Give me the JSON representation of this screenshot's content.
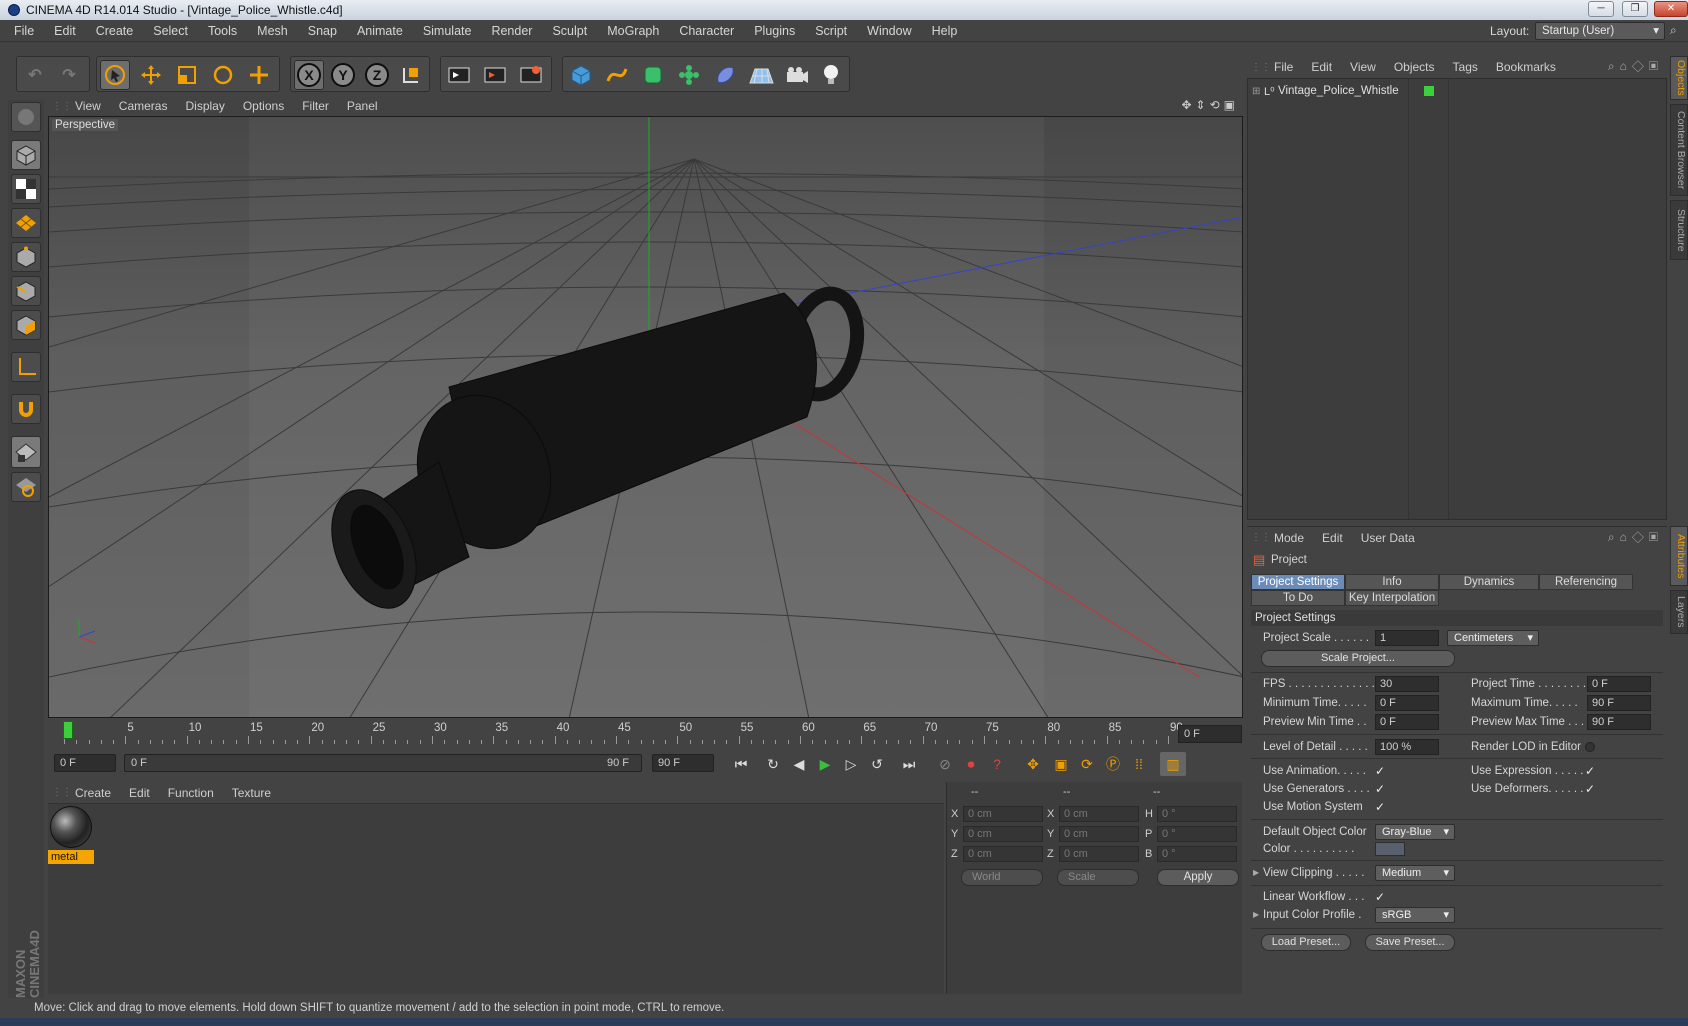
{
  "title": "CINEMA 4D R14.014 Studio - [Vintage_Police_Whistle.c4d]",
  "window": {
    "min": "─",
    "max": "❐",
    "close": "✕"
  },
  "menubar": [
    "File",
    "Edit",
    "Create",
    "Select",
    "Tools",
    "Mesh",
    "Snap",
    "Animate",
    "Simulate",
    "Render",
    "Sculpt",
    "MoGraph",
    "Character",
    "Plugins",
    "Script",
    "Window",
    "Help"
  ],
  "layout": {
    "label": "Layout:",
    "value": "Startup (User)"
  },
  "toolbar": {
    "axes": [
      "X",
      "Y",
      "Z"
    ]
  },
  "viewport": {
    "menu": [
      "View",
      "Cameras",
      "Display",
      "Options",
      "Filter",
      "Panel"
    ],
    "label": "Perspective"
  },
  "timeline": {
    "ticks": [
      "0",
      "5",
      "10",
      "15",
      "20",
      "25",
      "30",
      "35",
      "40",
      "45",
      "50",
      "55",
      "60",
      "65",
      "70",
      "75",
      "80",
      "85",
      "90"
    ],
    "current_frame": "0 F"
  },
  "transport": {
    "start": "0 F",
    "range_start": "0 F",
    "range_end": "90 F",
    "end": "90 F"
  },
  "material_manager": {
    "menu": [
      "Create",
      "Edit",
      "Function",
      "Texture"
    ],
    "materials": [
      {
        "name": "metal"
      }
    ]
  },
  "coordinates": {
    "headers": [
      "--",
      "--",
      "--"
    ],
    "rows": [
      {
        "l1": "X",
        "v1": "0 cm",
        "l2": "X",
        "v2": "0 cm",
        "l3": "H",
        "v3": "0 °"
      },
      {
        "l1": "Y",
        "v1": "0 cm",
        "l2": "Y",
        "v2": "0 cm",
        "l3": "P",
        "v3": "0 °"
      },
      {
        "l1": "Z",
        "v1": "0 cm",
        "l2": "Z",
        "v2": "0 cm",
        "l3": "B",
        "v3": "0 °"
      }
    ],
    "mode1": "World",
    "mode2": "Scale",
    "apply": "Apply"
  },
  "status": "Move: Click and drag to move elements. Hold down SHIFT to quantize movement / add to the selection in point mode, CTRL to remove.",
  "object_manager": {
    "menu": [
      "File",
      "Edit",
      "View",
      "Objects",
      "Tags",
      "Bookmarks"
    ],
    "objects": [
      {
        "name": "Vintage_Police_Whistle"
      }
    ]
  },
  "side_tabs": [
    "Objects",
    "Content Browser",
    "Structure",
    "Attributes",
    "Layers"
  ],
  "attributes": {
    "menu": [
      "Mode",
      "Edit",
      "User Data"
    ],
    "object": "Project",
    "tabs": [
      "Project Settings",
      "Info",
      "Dynamics",
      "Referencing",
      "To Do",
      "Key Interpolation"
    ],
    "section": "Project Settings",
    "project_scale": {
      "label": "Project Scale . . . . . .",
      "value": "1",
      "unit": "Centimeters"
    },
    "scale_button": "Scale Project...",
    "fps": {
      "label": "FPS . . . . . . . . . . . . . . .",
      "value": "30"
    },
    "project_time": {
      "label": "Project Time . . . . . . . .",
      "value": "0 F"
    },
    "min_time": {
      "label": "Minimum Time. . . . .",
      "value": "0 F"
    },
    "max_time": {
      "label": "Maximum Time. . . . .",
      "value": "90 F"
    },
    "prev_min": {
      "label": "Preview Min Time . .",
      "value": "0 F"
    },
    "prev_max": {
      "label": "Preview Max Time . . .",
      "value": "90 F"
    },
    "lod": {
      "label": "Level of Detail . . . . .",
      "value": "100 %"
    },
    "render_lod": "Render LOD in Editor",
    "use_animation": "Use Animation. . . . .",
    "use_expression": "Use Expression . . . . .",
    "use_generators": "Use Generators . . . .",
    "use_deformers": "Use Deformers. . . . . .",
    "use_motion": "Use Motion System",
    "default_color": {
      "label": "Default Object Color",
      "value": "Gray-Blue"
    },
    "color_label": "Color . . . . . . . . . .",
    "view_clipping": {
      "label": "View Clipping . . . . .",
      "value": "Medium"
    },
    "linear_workflow": "Linear Workflow . . .",
    "input_profile": {
      "label": "Input Color Profile .",
      "value": "sRGB"
    },
    "load_preset": "Load Preset...",
    "save_preset": "Save Preset...",
    "check": "✓"
  },
  "colors": {
    "accent": "#6b8cb8",
    "material_label": "#f5a500",
    "x_axis": "#cc3333",
    "y_axis": "#22aa22",
    "z_axis": "#3344cc"
  }
}
